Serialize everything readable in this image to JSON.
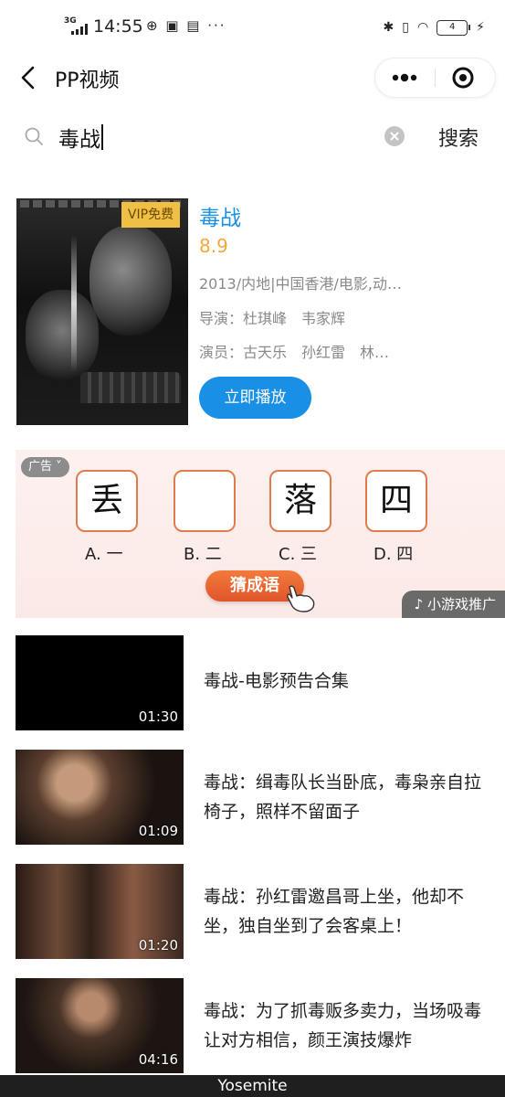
{
  "status_bar": {
    "network": "3G",
    "time": "14:55",
    "battery": "4"
  },
  "nav": {
    "title": "PP视频"
  },
  "search": {
    "query": "毒战",
    "button": "搜索"
  },
  "movie": {
    "title": "毒战",
    "score": "8.9",
    "badge": "VIP免费",
    "meta": "2013/内地|中国香港/电影,动…",
    "director": "导演：杜琪峰　韦家辉",
    "actors": "演员：古天乐　孙红雷　林…",
    "play_button": "立即播放"
  },
  "ad": {
    "tag": "广告",
    "chars": [
      "丢",
      "",
      "落",
      "四"
    ],
    "options": [
      "A. 一",
      "B. 二",
      "C. 三",
      "D. 四"
    ],
    "cta": "猜成语",
    "promo": "小游戏推广"
  },
  "videos": [
    {
      "title": "毒战-电影预告合集",
      "duration": "01:30"
    },
    {
      "title": "毒战：缉毒队长当卧底，毒枭亲自拉椅子，照样不留面子",
      "duration": "01:09"
    },
    {
      "title": "毒战：孙红雷邀昌哥上坐，他却不坐，独自坐到了会客桌上！",
      "duration": "01:20"
    },
    {
      "title": "毒战：为了抓毒贩多卖力，当场吸毒让对方相信，颜王演技爆炸",
      "duration": "04:16"
    }
  ],
  "bottom_bar": "Yosemite"
}
